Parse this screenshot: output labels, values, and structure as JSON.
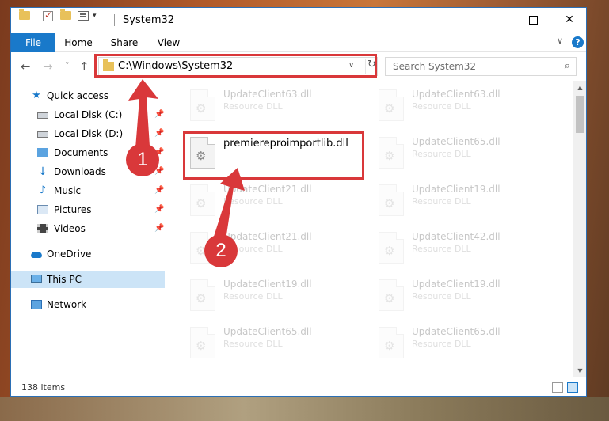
{
  "window": {
    "title": "System32",
    "dropdown_glyph": "▾",
    "controls": {
      "minimize": "",
      "maximize": "",
      "close": "✕"
    }
  },
  "ribbon": {
    "tabs": [
      "File",
      "Home",
      "Share",
      "View"
    ],
    "chevron": "∨",
    "help": "?"
  },
  "nav": {
    "back": "←",
    "forward": "→",
    "recent": "˅",
    "up": "↑"
  },
  "address": {
    "path": "C:\\Windows\\System32",
    "dropdown": "∨",
    "refresh": "↻"
  },
  "search": {
    "placeholder": "Search System32",
    "icon": "⌕"
  },
  "sidebar": {
    "items": [
      {
        "label": "Quick access",
        "icon": "star-icon",
        "pinned": false
      },
      {
        "label": "Local Disk (C:)",
        "icon": "disk-icon",
        "pinned": true
      },
      {
        "label": "Local Disk (D:)",
        "icon": "disk-icon",
        "pinned": true
      },
      {
        "label": "Documents",
        "icon": "documents-icon",
        "pinned": true
      },
      {
        "label": "Downloads",
        "icon": "downloads-icon",
        "pinned": true
      },
      {
        "label": "Music",
        "icon": "music-icon",
        "pinned": true
      },
      {
        "label": "Pictures",
        "icon": "pictures-icon",
        "pinned": true
      },
      {
        "label": "Videos",
        "icon": "videos-icon",
        "pinned": true
      },
      {
        "label": "OneDrive",
        "icon": "cloud-icon",
        "pinned": false
      },
      {
        "label": "This PC",
        "icon": "computer-icon",
        "pinned": false,
        "selected": true
      },
      {
        "label": "Network",
        "icon": "network-icon",
        "pinned": false
      }
    ],
    "pin_glyph": "📌",
    "star_glyph": "★",
    "down_glyph": "↓",
    "music_glyph": "♪"
  },
  "files": {
    "highlighted": {
      "name": "premiereproimportlib.dll",
      "type": ""
    },
    "left_column": [
      {
        "name": "UpdateClient63.dll",
        "type": "Resource DLL"
      },
      {
        "name": "UpdateClient21.dll",
        "type": "Resource DLL"
      },
      {
        "name": "UpdateClient21.dll",
        "type": "Resource DLL"
      },
      {
        "name": "UpdateClient19.dll",
        "type": "Resource DLL"
      },
      {
        "name": "UpdateClient65.dll",
        "type": "Resource DLL"
      }
    ],
    "right_column": [
      {
        "name": "UpdateClient63.dll",
        "type": "Resource DLL"
      },
      {
        "name": "UpdateClient65.dll",
        "type": "Resource DLL"
      },
      {
        "name": "UpdateClient19.dll",
        "type": "Resource DLL"
      },
      {
        "name": "UpdateClient42.dll",
        "type": "Resource DLL"
      },
      {
        "name": "UpdateClient19.dll",
        "type": "Resource DLL"
      },
      {
        "name": "UpdateClient65.dll",
        "type": "Resource DLL"
      }
    ],
    "gear_glyph": "⚙"
  },
  "scrollbar": {
    "up": "▲",
    "down": "▼"
  },
  "status": {
    "item_count": "138 items"
  },
  "annotations": {
    "marker_1": "1",
    "marker_2": "2"
  },
  "colors": {
    "accent": "#1979ca",
    "highlight_red": "#d9383a",
    "selected_bg": "#cce4f7"
  }
}
